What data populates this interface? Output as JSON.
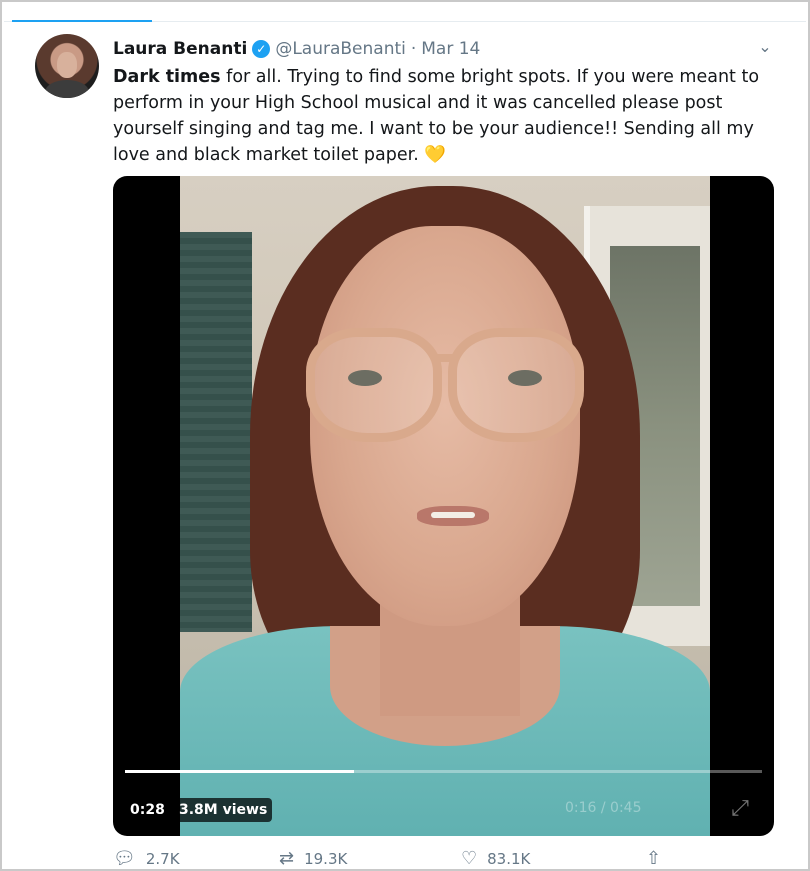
{
  "tweet": {
    "author_name": "Laura Benanti",
    "verified": true,
    "handle": "@LauraBenanti",
    "separator": "·",
    "date": "Mar 14",
    "text_bold": "Dark times",
    "text_rest": " for all. Trying to find some bright spots. If you were meant to perform in your High School musical and it was cancelled please post yourself singing and tag me. I want to be your audience!! Sending all my love and black market toilet paper.",
    "emoji": "💛"
  },
  "video": {
    "elapsed": "0:28",
    "views": "3.8M views",
    "overlay_time": "0:16 / 0:45",
    "progress_fraction": 0.36
  },
  "actions": {
    "reply_count": "2.7K",
    "retweet_count": "19.3K",
    "like_count": "83.1K"
  },
  "icons": {
    "verified": "check-badge-icon",
    "menu": "chevron-down-icon",
    "reply": "reply-icon",
    "retweet": "retweet-icon",
    "like": "heart-icon",
    "share": "share-icon",
    "expand": "expand-icon"
  },
  "colors": {
    "accent": "#1da1f2",
    "secondary_text": "#657786",
    "heart_emoji": "#f7c948"
  }
}
